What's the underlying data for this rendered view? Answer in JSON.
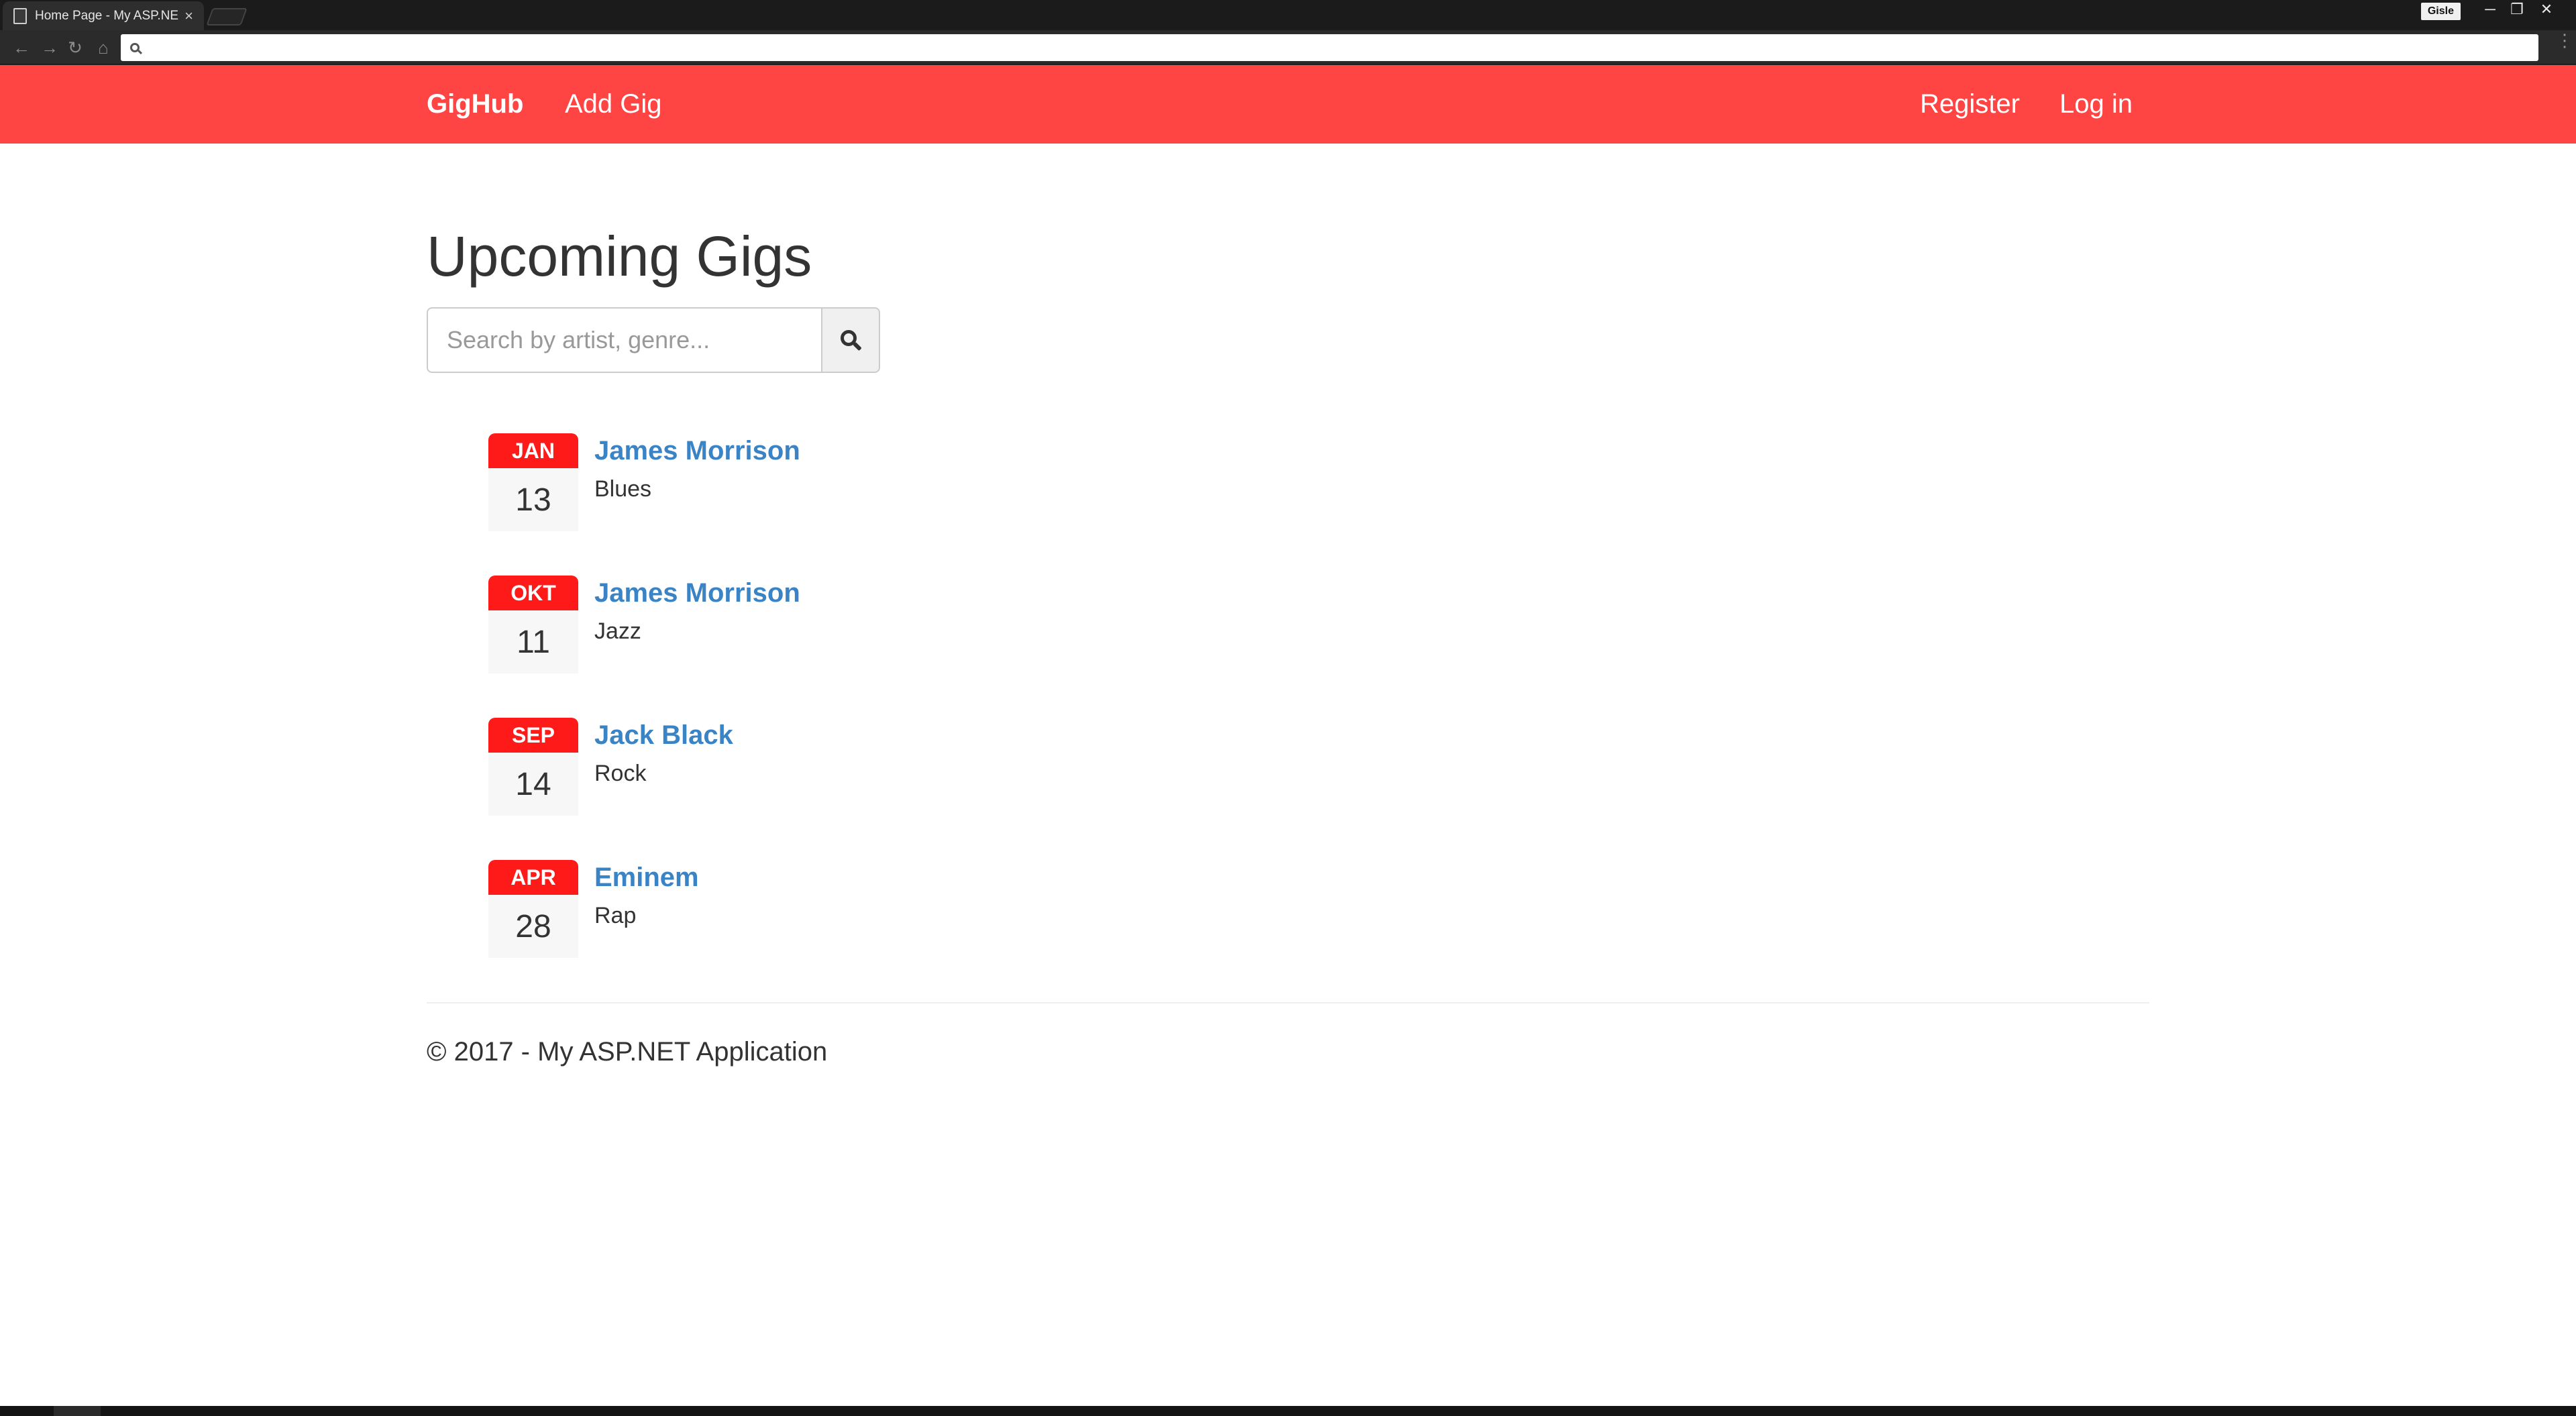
{
  "browser": {
    "tab_title": "Home Page - My ASP.NE",
    "tab_close": "×",
    "profile_name": "Gisle",
    "win_min": "─",
    "win_max": "❐",
    "win_close": "✕",
    "nav_back": "←",
    "nav_forward": "→",
    "nav_reload": "↻",
    "nav_home": "⌂",
    "url": "",
    "menu": "⋮"
  },
  "navbar": {
    "brand": "GigHub",
    "add_gig": "Add Gig",
    "register": "Register",
    "login": "Log in",
    "color": "#ff4444"
  },
  "main": {
    "title": "Upcoming Gigs",
    "search": {
      "placeholder": "Search by artist, genre..."
    },
    "gigs": [
      {
        "month": "JAN",
        "day": "13",
        "artist": "James Morrison",
        "genre": "Blues"
      },
      {
        "month": "OKT",
        "day": "11",
        "artist": "James Morrison",
        "genre": "Jazz"
      },
      {
        "month": "SEP",
        "day": "14",
        "artist": "Jack Black",
        "genre": "Rock"
      },
      {
        "month": "APR",
        "day": "28",
        "artist": "Eminem",
        "genre": "Rap"
      }
    ]
  },
  "footer": {
    "text": "© 2017 - My ASP.NET Application"
  },
  "colors": {
    "link": "#3a83c4",
    "calendar_month": "#ff1a1a",
    "navbar": "#ff4444"
  }
}
